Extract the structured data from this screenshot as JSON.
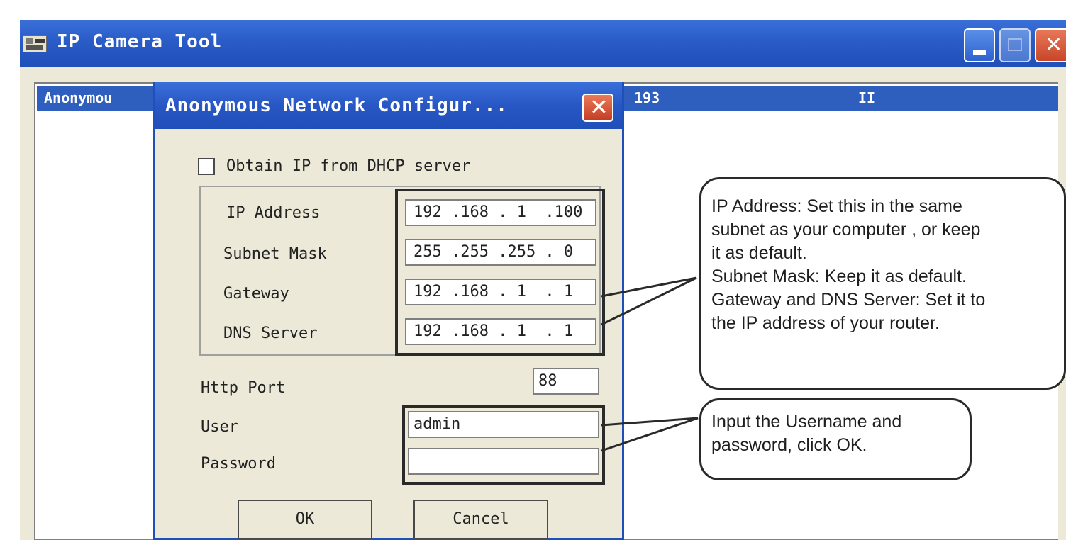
{
  "window": {
    "title": "IP Camera Tool"
  },
  "device_list": {
    "row": {
      "name": "Anonymou",
      "ip_fragment": "193",
      "col3": "II"
    }
  },
  "dialog": {
    "title": "Anonymous Network Configur...",
    "dhcp_label": "Obtain IP from DHCP server",
    "dhcp_checked": false,
    "fields": {
      "ip_address": {
        "label": "IP Address",
        "value": "192 .168 . 1  .100"
      },
      "subnet_mask": {
        "label": "Subnet Mask",
        "value": "255 .255 .255 . 0"
      },
      "gateway": {
        "label": "Gateway",
        "value": "192 .168 . 1  . 1"
      },
      "dns_server": {
        "label": "DNS Server",
        "value": "192 .168 . 1  . 1"
      }
    },
    "http_port": {
      "label": "Http Port",
      "value": "88"
    },
    "user": {
      "label": "User",
      "value": "admin"
    },
    "password": {
      "label": "Password",
      "value": ""
    },
    "ok_label": "OK",
    "cancel_label": "Cancel"
  },
  "callouts": {
    "network": [
      "IP Address: Set this in the same",
      "subnet as your computer , or keep",
      "it as default.",
      "Subnet Mask: Keep it as default.",
      "Gateway and DNS Server: Set it to",
      "the IP address of your router."
    ],
    "credentials": [
      "Input the Username and",
      "password, click OK."
    ]
  },
  "colors": {
    "titlebar_blue": "#2a5cc8",
    "selection_blue": "#2f5fbe",
    "window_face": "#ece9d8",
    "close_red": "#c8462a"
  },
  "icons": [
    "app-icon",
    "minimize-icon",
    "maximize-icon",
    "close-icon"
  ]
}
